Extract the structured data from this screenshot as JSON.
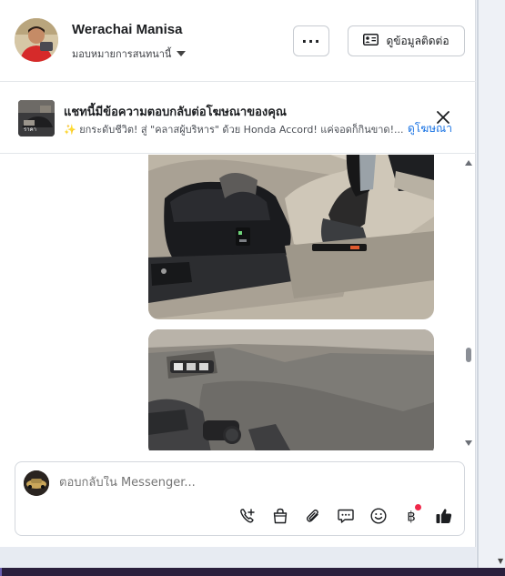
{
  "header": {
    "name": "Werachai Manisa",
    "assign_label": "มอบหมายการสนทนานี้",
    "more_label": "···",
    "contact_label": "ดูข้อมูลติดต่อ"
  },
  "ad": {
    "title": "แชทนี้มีข้อความตอบกลับต่อโฆษณาของคุณ",
    "text": "✨ ยกระดับชีวิต! สู่ \"คลาสผู้บริหาร\" ด้วย Honda Accord! แค่จอดก็กินขาด!...",
    "link": "ดูโฆษณา",
    "thumb_text": "ราคา"
  },
  "composer": {
    "placeholder": "ตอบกลับใน Messenger..."
  },
  "icons": {
    "tools": [
      "call-add-icon",
      "bag-icon",
      "paperclip-icon",
      "saved-reply-icon",
      "emoji-icon",
      "baht-icon",
      "thumbs-up-icon"
    ]
  },
  "colors": {
    "accent": "#1b74e4",
    "badge": "#f0284a",
    "like": "#1c1e21"
  }
}
